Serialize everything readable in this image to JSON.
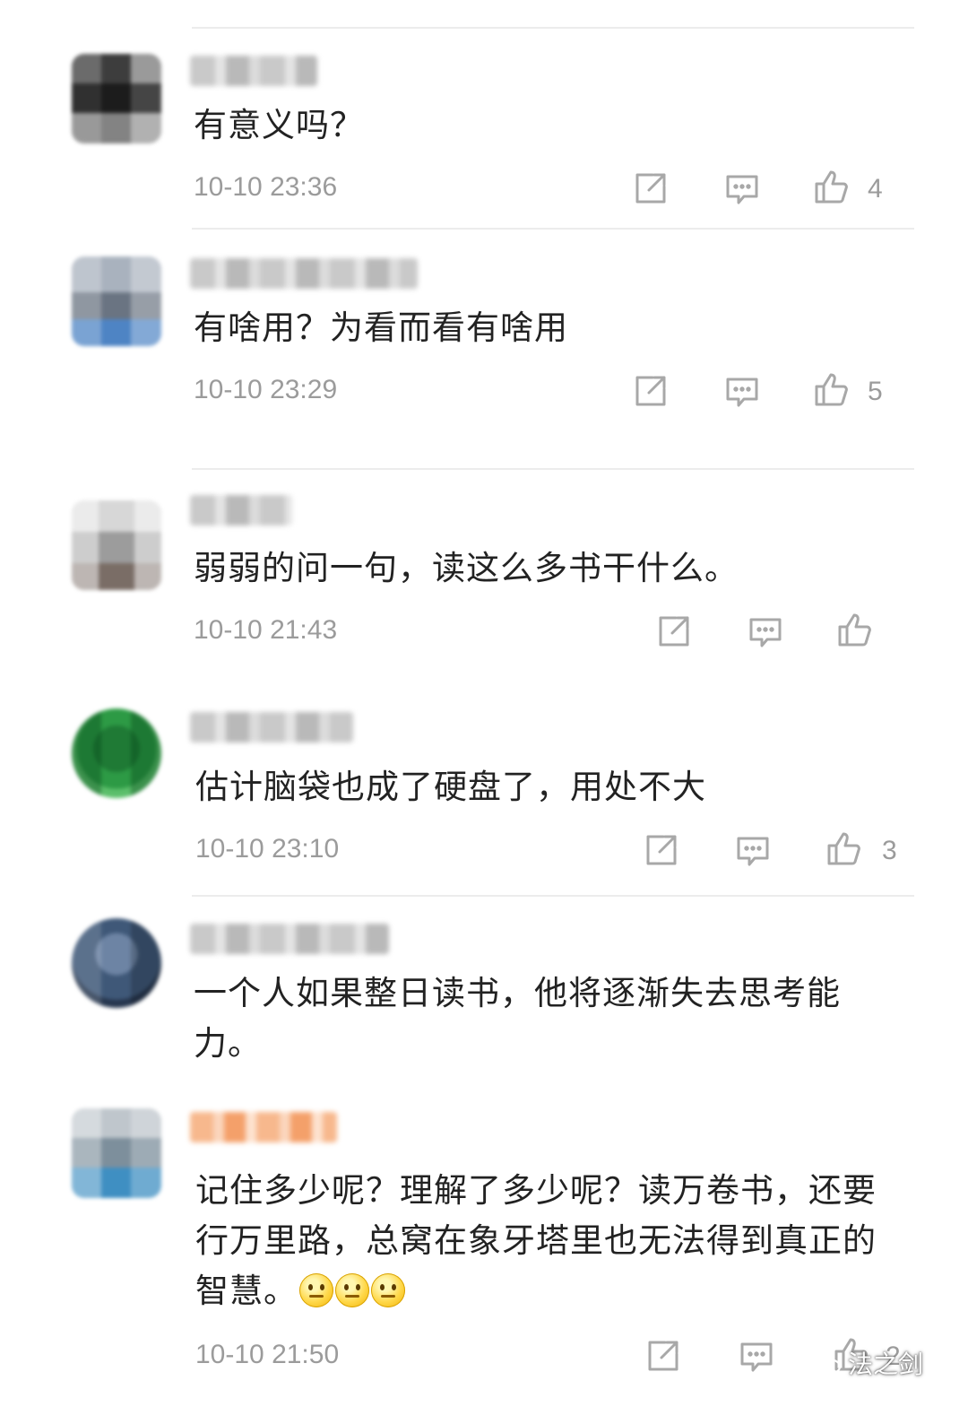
{
  "comments": [
    {
      "text": "有意义吗？",
      "time": "10-10 23:36",
      "likes": "4"
    },
    {
      "text": "有啥用？为看而看有啥用",
      "time": "10-10 23:29",
      "likes": "5"
    },
    {
      "text": "弱弱的问一句，读这么多书干什么。",
      "time": "10-10 21:43",
      "likes": ""
    },
    {
      "text": "估计脑袋也成了硬盘了，用处不大",
      "time": "10-10 23:10",
      "likes": "3"
    },
    {
      "text": "一个人如果整日读书，他将逐渐失去思考能力。",
      "time": "",
      "likes": ""
    },
    {
      "text": "记住多少呢？理解了多少呢？读万卷书，还要行万里路，总窝在象牙塔里也无法得到真正的智慧。",
      "time": "10-10 21:50",
      "likes": "2"
    }
  ],
  "icons": {
    "share": "share-icon",
    "reply": "reply-icon",
    "like": "thumbs-up-icon",
    "emoji": "smile-emoji-icon",
    "watermark": "wechat-logo-icon"
  },
  "watermark": {
    "text": "法之剑"
  },
  "colors": {
    "text": "#222222",
    "meta": "#9b9b9b",
    "divider": "#ececec"
  }
}
